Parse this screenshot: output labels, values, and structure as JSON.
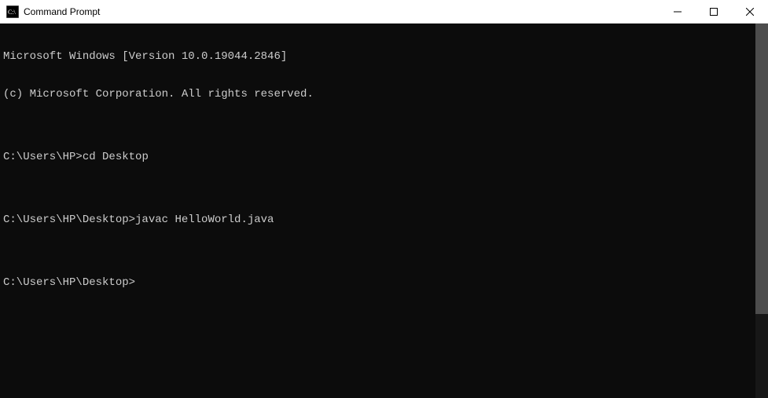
{
  "titlebar": {
    "title": "Command Prompt"
  },
  "terminal": {
    "header1": "Microsoft Windows [Version 10.0.19044.2846]",
    "header2": "(c) Microsoft Corporation. All rights reserved.",
    "blank": "",
    "prompt1_path": "C:\\Users\\HP>",
    "prompt1_cmd": "cd Desktop",
    "prompt2_path": "C:\\Users\\HP\\Desktop>",
    "prompt2_cmd": "javac HelloWorld.java",
    "prompt3_path": "C:\\Users\\HP\\Desktop>",
    "prompt3_cmd": ""
  }
}
